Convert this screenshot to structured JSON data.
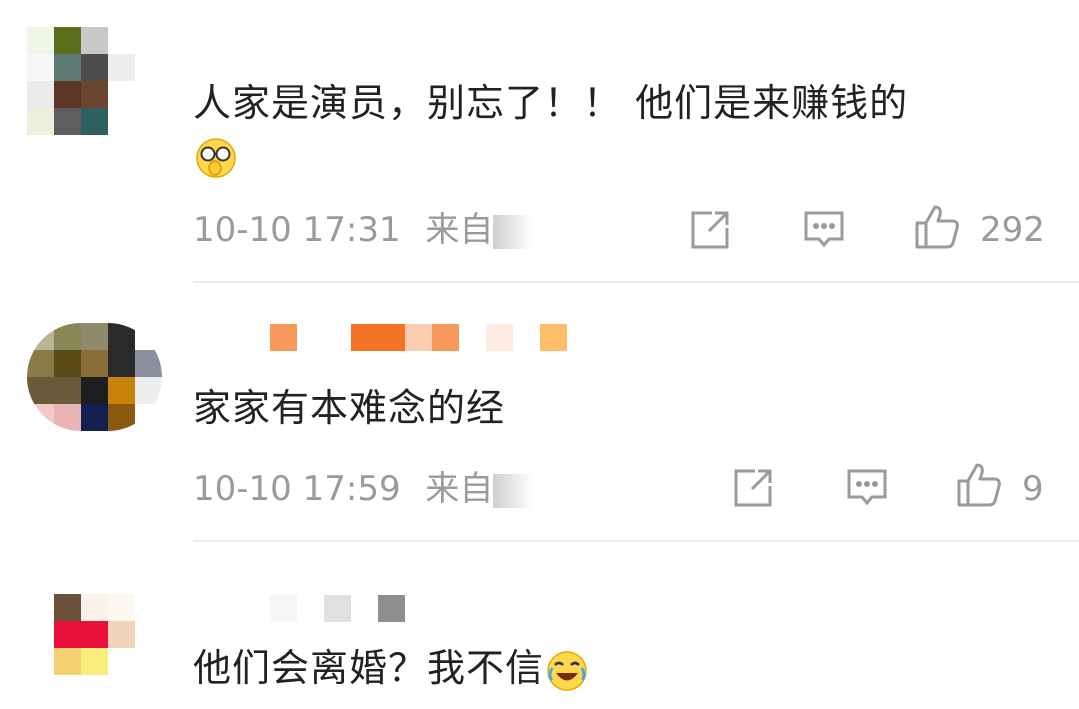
{
  "comments": [
    {
      "text": "人家是演员，别忘了！！ 他们是来赚钱的",
      "emoji": "glasses-cover-face-emoji",
      "time": "10-10 17:31",
      "source_prefix": "来自",
      "likes": "292"
    },
    {
      "text": "家家有本难念的经",
      "time": "10-10 17:59",
      "source_prefix": "来自",
      "likes": "9"
    },
    {
      "text": "他们会离婚？我不信",
      "emoji": "laugh-cry-emoji"
    }
  ],
  "icons": {
    "share": "share-icon",
    "comment": "comment-icon",
    "like": "thumbs-up-icon"
  },
  "colors": {
    "text": "#222222",
    "meta": "#9a9a9a",
    "divider": "#ececec"
  }
}
